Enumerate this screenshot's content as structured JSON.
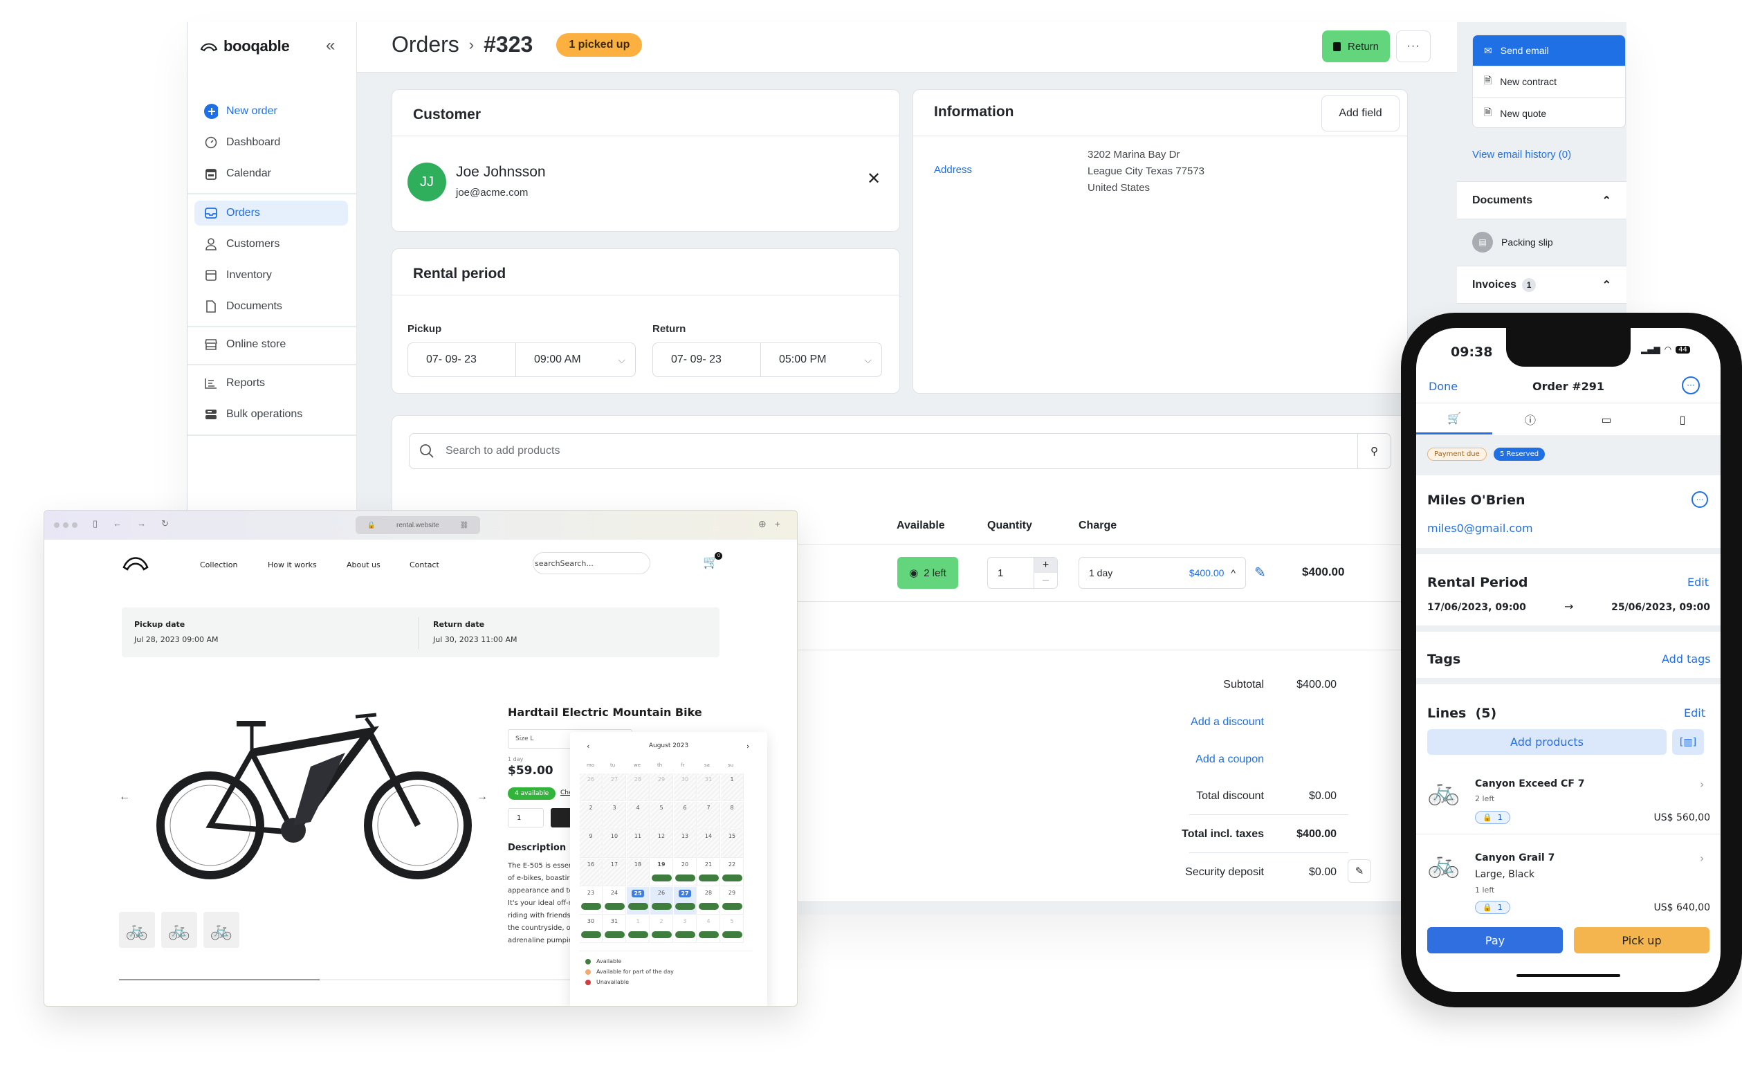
{
  "app": {
    "brand": "booqable",
    "sidebar": {
      "items": [
        {
          "label": "New order",
          "icon": "plus-icon"
        },
        {
          "label": "Dashboard",
          "icon": "dashboard-icon"
        },
        {
          "label": "Calendar",
          "icon": "calendar-icon"
        },
        {
          "label": "Orders",
          "icon": "inbox-icon",
          "active": true
        },
        {
          "label": "Customers",
          "icon": "user-icon"
        },
        {
          "label": "Inventory",
          "icon": "box-icon"
        },
        {
          "label": "Documents",
          "icon": "document-icon"
        },
        {
          "label": "Online store",
          "icon": "store-icon"
        },
        {
          "label": "Reports",
          "icon": "reports-icon"
        },
        {
          "label": "Bulk operations",
          "icon": "bulk-icon"
        }
      ]
    },
    "header": {
      "breadcrumb_root": "Orders",
      "order_id": "#323",
      "status_badge": "1 picked up",
      "return_label": "Return",
      "more_label": "···"
    },
    "customer": {
      "title": "Customer",
      "initials": "JJ",
      "name": "Joe Johnsson",
      "email": "joe@acme.com"
    },
    "rental_period": {
      "title": "Rental period",
      "pickup_label": "Pickup",
      "pickup_date": "07- 09- 23",
      "pickup_time": "09:00 AM",
      "return_label": "Return",
      "return_date": "07- 09- 23",
      "return_time": "05:00 PM"
    },
    "information": {
      "title": "Information",
      "add_field": "Add field",
      "address_label": "Address",
      "address_lines": [
        "3202 Marina Bay Dr",
        "League City Texas 77573",
        "United States"
      ]
    },
    "products": {
      "search_placeholder": "Search to add products",
      "columns": {
        "available": "Available",
        "quantity": "Quantity",
        "charge": "Charge"
      },
      "line": {
        "available": "2 left",
        "quantity": "1",
        "charge_period": "1 day",
        "charge_amount": "$400.00",
        "total": "$400.00"
      }
    },
    "totals": {
      "subtotal_label": "Subtotal",
      "subtotal": "$400.00",
      "add_discount": "Add a discount",
      "add_coupon": "Add a coupon",
      "total_discount_label": "Total discount",
      "total_discount": "$0.00",
      "total_label": "Total incl. taxes",
      "total": "$400.00",
      "deposit_label": "Security deposit",
      "deposit": "$0.00"
    },
    "right_panel": {
      "send_email": "Send email",
      "new_contract": "New contract",
      "new_quote": "New quote",
      "email_history": "View email history (0)",
      "documents_title": "Documents",
      "packing_slip": "Packing slip",
      "invoices_title": "Invoices",
      "invoices_count": "1"
    }
  },
  "browser": {
    "url": "rental.website",
    "nav": [
      "Collection",
      "How it works",
      "About us",
      "Contact"
    ],
    "search_placeholder": "searchSearch...",
    "cart_count": "0",
    "pickup_label": "Pickup date",
    "pickup_value": "Jul 28, 2023 09:00 AM",
    "return_label": "Return date",
    "return_value": "Jul 30, 2023 11:00 AM",
    "product": {
      "title": "Hardtail Electric Mountain Bike",
      "size": "Size L",
      "period": "1 day",
      "price": "$59.00",
      "availability": "4 available",
      "check_link": "Che",
      "quantity": "1",
      "description_title": "Description",
      "description_lines": [
        "The E-505 is esser",
        "of e-bikes, boastir",
        "appearance and tc",
        "It's your ideal off-r",
        "riding with friends",
        "the countryside, o",
        "adrenaline pumpir"
      ]
    },
    "calendar": {
      "month": "August 2023",
      "weekdays": [
        "mo",
        "tu",
        "we",
        "th",
        "fr",
        "sa",
        "su"
      ],
      "weeks": [
        [
          "26",
          "27",
          "28",
          "29",
          "30",
          "31",
          "1"
        ],
        [
          "2",
          "3",
          "4",
          "5",
          "6",
          "7",
          "8"
        ],
        [
          "9",
          "10",
          "11",
          "12",
          "13",
          "14",
          "15"
        ],
        [
          "16",
          "17",
          "18",
          "19",
          "20",
          "21",
          "22"
        ],
        [
          "23",
          "24",
          "25",
          "26",
          "27",
          "28",
          "29"
        ],
        [
          "30",
          "31",
          "1",
          "2",
          "3",
          "4",
          "5"
        ]
      ],
      "selected_start": "25",
      "selected_end": "27",
      "legend": [
        {
          "label": "Available",
          "color": "#3e7d3e"
        },
        {
          "label": "Available for part of the day",
          "color": "#f2ab6d"
        },
        {
          "label": "Unavailable",
          "color": "#d23b3b"
        }
      ]
    }
  },
  "phone": {
    "time": "09:38",
    "battery": "44",
    "done": "Done",
    "title": "Order #291",
    "badges": {
      "payment": "Payment due",
      "reserved": "5 Reserved"
    },
    "customer_name": "Miles O'Brien",
    "customer_email": "miles0@gmail.com",
    "rental_title": "Rental Period",
    "edit": "Edit",
    "rental_start": "17/06/2023, 09:00",
    "rental_end": "25/06/2023, 09:00",
    "tags_title": "Tags",
    "add_tags": "Add tags",
    "lines_title": "Lines  (5)",
    "lines_edit": "Edit",
    "add_products": "Add products",
    "lines": [
      {
        "name": "Canyon Exceed CF 7",
        "variant": "",
        "left": "2 left",
        "locked": "1",
        "price": "US$ 560,00"
      },
      {
        "name": "Canyon Grail 7",
        "variant": "Large, Black",
        "left": "1 left",
        "locked": "1",
        "price": "US$ 640,00"
      }
    ],
    "pay": "Pay",
    "pickup": "Pick up"
  },
  "colors": {
    "primary": "#1f6fe5",
    "success": "#62d57d",
    "warning": "#fbb040",
    "pickup_btn": "#f4b54f"
  }
}
